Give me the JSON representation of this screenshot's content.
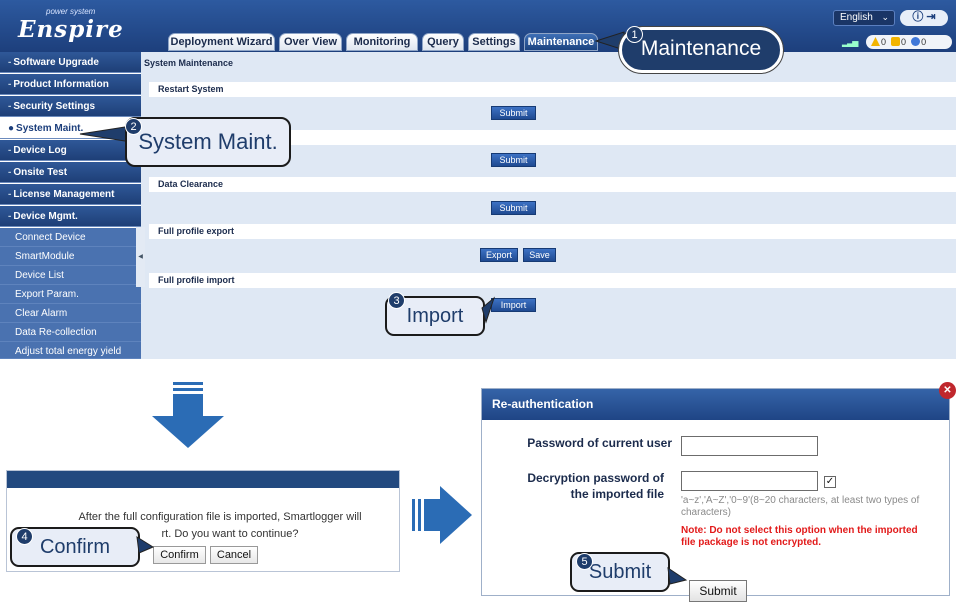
{
  "header": {
    "brand_sub": "power system",
    "brand_main": "Enspire",
    "language": "English",
    "user_icons": "ⓘ ⇥",
    "tabs": [
      {
        "label": "Deployment Wizard"
      },
      {
        "label": "Over View"
      },
      {
        "label": "Monitoring"
      },
      {
        "label": "Query"
      },
      {
        "label": "Settings"
      },
      {
        "label": "Maintenance"
      }
    ],
    "alarm_major": "0",
    "alarm_minor": "0",
    "alarm_warning": "0"
  },
  "sidebar": {
    "items": [
      {
        "label": "Software Upgrade"
      },
      {
        "label": "Product Information"
      },
      {
        "label": "Security Settings"
      },
      {
        "label": "System Maint."
      },
      {
        "label": "Device Log"
      },
      {
        "label": "Onsite Test"
      },
      {
        "label": "License Management"
      },
      {
        "label": "Device Mgmt."
      }
    ],
    "sub_items": [
      {
        "label": "Connect Device"
      },
      {
        "label": "SmartModule"
      },
      {
        "label": "Device List"
      },
      {
        "label": "Export Param."
      },
      {
        "label": "Clear Alarm"
      },
      {
        "label": "Data Re-collection"
      },
      {
        "label": "Adjust total energy yield"
      }
    ]
  },
  "main": {
    "title": "System Maintenance",
    "sections": [
      {
        "heading": "Restart System",
        "buttons": [
          "Submit"
        ]
      },
      {
        "heading": "",
        "buttons": [
          "Submit"
        ]
      },
      {
        "heading": "Data Clearance",
        "buttons": [
          "Submit"
        ]
      },
      {
        "heading": "Full profile export",
        "buttons": [
          "Export",
          "Save"
        ]
      },
      {
        "heading": "Full profile import",
        "buttons": [
          "Import"
        ]
      }
    ]
  },
  "callouts": {
    "c1": {
      "num": "1",
      "text": "Maintenance"
    },
    "c2": {
      "num": "2",
      "text": "System Maint."
    },
    "c3": {
      "num": "3",
      "text": "Import"
    },
    "c4": {
      "num": "4",
      "text": "Confirm"
    },
    "c5": {
      "num": "5",
      "text": "Submit"
    }
  },
  "confirm_dialog": {
    "message_line1": "After the full configuration file is imported, Smartlogger will",
    "message_line2": "rt. Do you want to continue?",
    "confirm_label": "Confirm",
    "cancel_label": "Cancel"
  },
  "reauth_dialog": {
    "title": "Re-authentication",
    "close_icon": "✕",
    "password_label": "Password of current user",
    "decrypt_label_line1": "Decryption password of",
    "decrypt_label_line2": "the imported file",
    "checkbox_mark": "✓",
    "hint": "'a~z','A~Z','0~9'(8~20 characters, at least two types of characters)",
    "note": "Note: Do not select this option when the imported file package is not encrypted.",
    "submit_label": "Submit"
  },
  "colors": {
    "header_blue": "#1d3f7c",
    "callout_blue": "#1f3d6b",
    "arrow_blue": "#2b6cb5",
    "note_red": "#e21a1a"
  }
}
